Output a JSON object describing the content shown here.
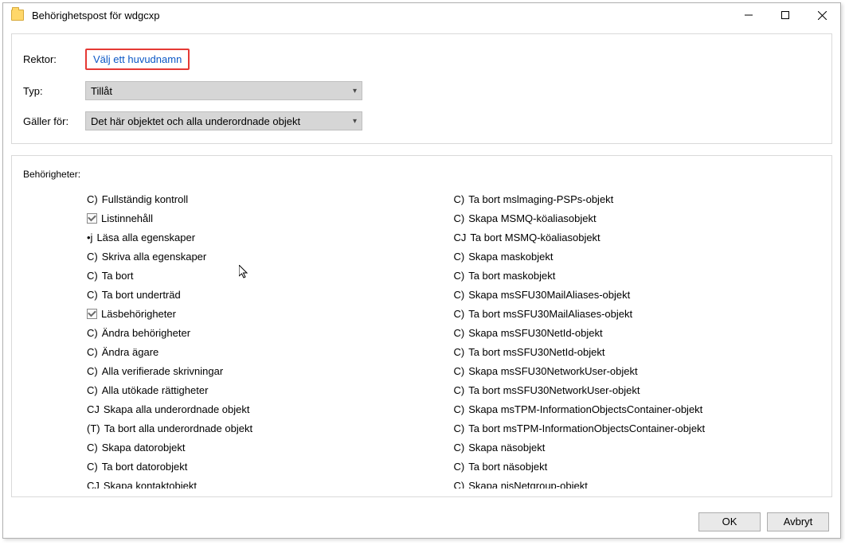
{
  "title": "Behörighetspost för wdgcxp",
  "form": {
    "rektor_label": "Rektor:",
    "rektor_link": "Välj ett huvudnamn",
    "typ_label": "Typ:",
    "typ_value": "Tillåt",
    "galler_label": "Gäller för:",
    "galler_value": "Det här objektet och alla underordnade objekt"
  },
  "perm_header": "Behörigheter:",
  "left_items": [
    {
      "prefix": "C)",
      "text": "Fullständig kontroll",
      "cb": false
    },
    {
      "prefix": "",
      "text": "Listinnehåll",
      "cb": true,
      "checked": true
    },
    {
      "prefix": "•j",
      "text": "Läsa alla egenskaper",
      "cb": false
    },
    {
      "prefix": "C)",
      "text": "Skriva alla egenskaper",
      "cb": false
    },
    {
      "prefix": "C)",
      "text": "Ta bort",
      "cb": false
    },
    {
      "prefix": "C)",
      "text": "Ta bort underträd",
      "cb": false
    },
    {
      "prefix": "",
      "text": "Läsbehörigheter",
      "cb": true,
      "checked": true
    },
    {
      "prefix": "C)",
      "text": "Ändra behörigheter",
      "cb": false
    },
    {
      "prefix": "C)",
      "text": "Ändra ägare",
      "cb": false
    },
    {
      "prefix": "C)",
      "text": "Alla vеrifierade skrivningar",
      "cb": false
    },
    {
      "prefix": "C)",
      "text": "Alla utökade rättigheter",
      "cb": false
    },
    {
      "prefix": "CJ",
      "text": "Skapa alla underordnade objekt",
      "cb": false
    },
    {
      "prefix": "(T)",
      "text": "Ta bort alla underordnade objekt",
      "cb": false
    },
    {
      "prefix": "C)",
      "text": "Skapa datorobjekt",
      "cb": false
    },
    {
      "prefix": "C)",
      "text": "Ta bort datorobjekt",
      "cb": false
    },
    {
      "prefix": "CJ",
      "text": "Skapa kontaktobjekt",
      "cb": false
    }
  ],
  "right_items": [
    {
      "prefix": "C)",
      "text": "Ta bort mslmaging-PSPs-objekt"
    },
    {
      "prefix": "C)",
      "text": "Skapa MSMQ-köaliasobjekt"
    },
    {
      "prefix": "CJ",
      "text": "Ta bort MSMQ-köaliasobjekt"
    },
    {
      "prefix": "C)",
      "text": "Skapa maskobjekt"
    },
    {
      "prefix": "C)",
      "text": "Ta bort maskobjekt"
    },
    {
      "prefix": "C)",
      "text": "Skapa msSFU30MailAliases-objekt"
    },
    {
      "prefix": "C)",
      "text": "Ta bort msSFU30MailAliases-objekt"
    },
    {
      "prefix": "C)",
      "text": "Skapa msSFU30NetId-objekt"
    },
    {
      "prefix": "C)",
      "text": "Ta bort msSFU30NetId-objekt"
    },
    {
      "prefix": "C)",
      "text": "Skapa msSFU30NetworkUser-objekt"
    },
    {
      "prefix": "C)",
      "text": "Ta bort msSFU30NetworkUser-objekt"
    },
    {
      "prefix": "C)",
      "text": "Skapa msTPM-InformationObjectsContainer-objekt"
    },
    {
      "prefix": "C)",
      "text": "Ta bort msTPM-InformationObjectsContainer-objekt"
    },
    {
      "prefix": "C)",
      "text": "Skapa näsobjekt"
    },
    {
      "prefix": "C)",
      "text": "Ta bort näsobjekt"
    },
    {
      "prefix": "C)",
      "text": "Skapa nisNetgroup-objekt"
    }
  ],
  "buttons": {
    "ok": "OK",
    "cancel": "Avbryt"
  }
}
